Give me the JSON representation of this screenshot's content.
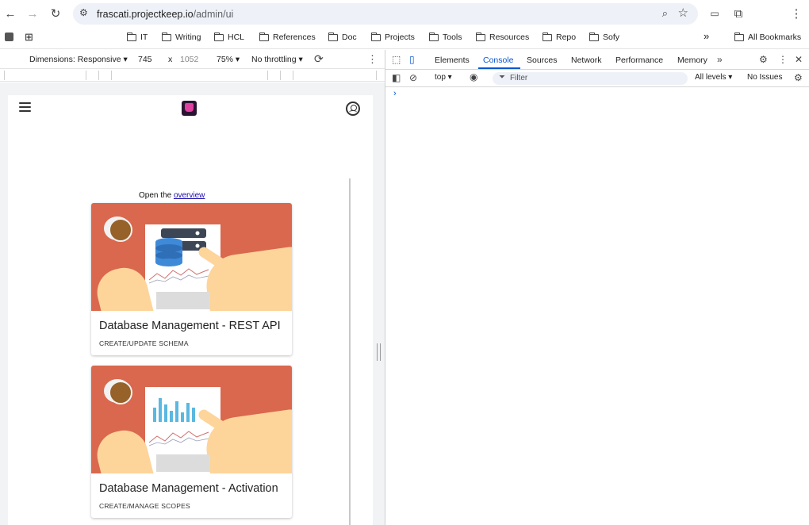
{
  "browser": {
    "url_host": "frascati.projectkeep.io",
    "url_path": "/admin/ui",
    "icons": [
      "back-arrow-icon",
      "forward-arrow-icon",
      "reload-icon",
      "site-settings-icon",
      "zoom-icon",
      "star-icon",
      "cast-icon",
      "extensions-icon",
      "more-icon"
    ]
  },
  "bookmarks": {
    "items": [
      "IT",
      "Writing",
      "HCL",
      "References",
      "Doc",
      "Projects",
      "Tools",
      "Resources",
      "Repo",
      "Sofy"
    ],
    "more_label": "»",
    "all_label": "All Bookmarks"
  },
  "device_toolbar": {
    "dimensions_label": "Dimensions: Responsive ▾",
    "width": "745",
    "times": "x",
    "height": "1052",
    "zoom": "75% ▾",
    "throttling": "No throttling ▾"
  },
  "page": {
    "open_prefix": "Open the",
    "open_link": "overview",
    "cards": [
      {
        "title": "Database Management - REST API",
        "subtitle": "CREATE/UPDATE SCHEMA"
      },
      {
        "title": "Database Management - Activation",
        "subtitle": "CREATE/MANAGE SCOPES"
      }
    ],
    "colors": {
      "card_bg": "#d9684e",
      "link": "#1a0dab"
    }
  },
  "devtools": {
    "tabs": [
      "Elements",
      "Console",
      "Sources",
      "Network",
      "Performance",
      "Memory"
    ],
    "active_tab": "Console",
    "context": "top ▾",
    "filter_placeholder": "Filter",
    "levels": "All levels ▾",
    "issues": "No Issues",
    "prompt": "›",
    "colors": {
      "accent": "#0b57d0"
    }
  }
}
